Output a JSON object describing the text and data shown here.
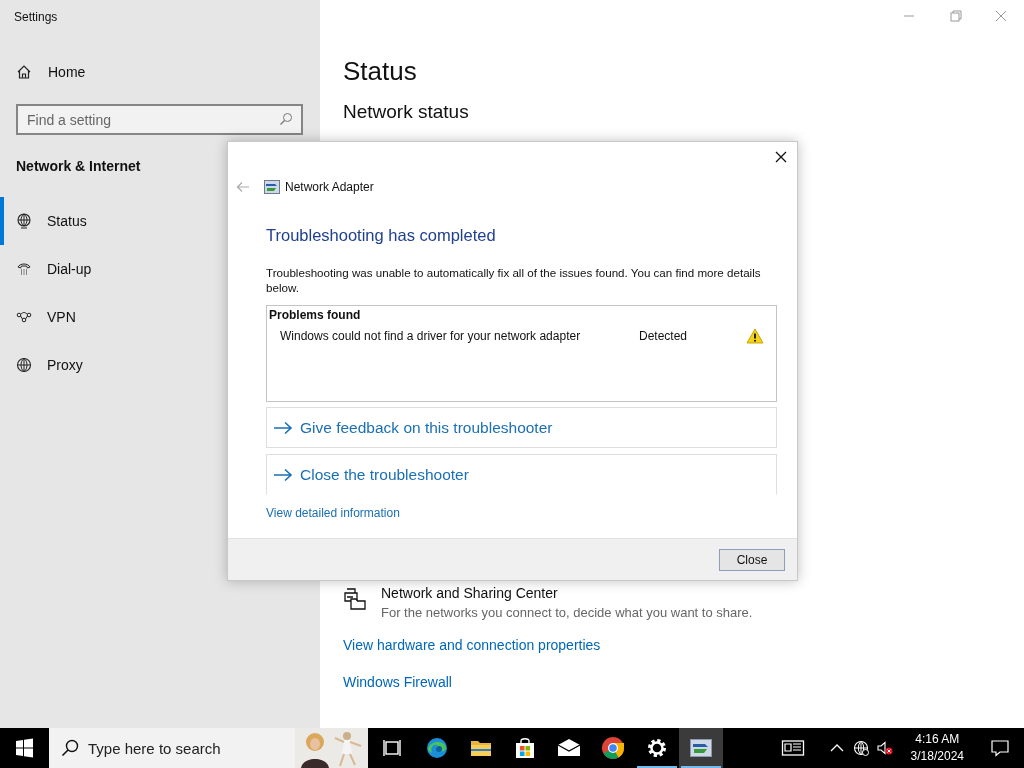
{
  "window": {
    "title": "Settings"
  },
  "sidebar": {
    "home": "Home",
    "search": {
      "placeholder": "Find a setting"
    },
    "section": "Network & Internet",
    "items": [
      {
        "label": "Status",
        "kind": "status",
        "selected": true
      },
      {
        "label": "Dial-up",
        "kind": "dialup",
        "selected": false
      },
      {
        "label": "VPN",
        "kind": "vpn",
        "selected": false
      },
      {
        "label": "Proxy",
        "kind": "proxy",
        "selected": false
      }
    ]
  },
  "main": {
    "title": "Status",
    "subtitle": "Network status",
    "sharing": {
      "title": "Network and Sharing Center",
      "description": "For the networks you connect to, decide what you want to share."
    },
    "links": [
      "View hardware and connection properties",
      "Windows Firewall"
    ]
  },
  "dialog": {
    "header": "Network Adapter",
    "heading": "Troubleshooting has completed",
    "message": "Troubleshooting was unable to automatically fix all of the issues found. You can find more details below.",
    "problems": {
      "heading": "Problems found",
      "rows": [
        {
          "problem": "Windows could not find a driver for your network adapter",
          "status": "Detected"
        }
      ]
    },
    "actions": [
      "Give feedback on this troubleshooter",
      "Close the troubleshooter"
    ],
    "details_link": "View detailed information",
    "button": "Close"
  },
  "taskbar": {
    "search": {
      "placeholder": "Type here to search"
    },
    "apps": [
      {
        "kind": "taskview",
        "running": false,
        "selected": false
      },
      {
        "kind": "edge",
        "running": false,
        "selected": false
      },
      {
        "kind": "explorer",
        "running": false,
        "selected": false
      },
      {
        "kind": "store",
        "running": false,
        "selected": false
      },
      {
        "kind": "mail",
        "running": false,
        "selected": false
      },
      {
        "kind": "chrome",
        "running": false,
        "selected": false
      },
      {
        "kind": "settings",
        "running": true,
        "selected": false
      },
      {
        "kind": "troubleshooter",
        "running": true,
        "selected": true
      }
    ],
    "clock": {
      "time": "4:16 AM",
      "date": "3/18/2024"
    }
  }
}
